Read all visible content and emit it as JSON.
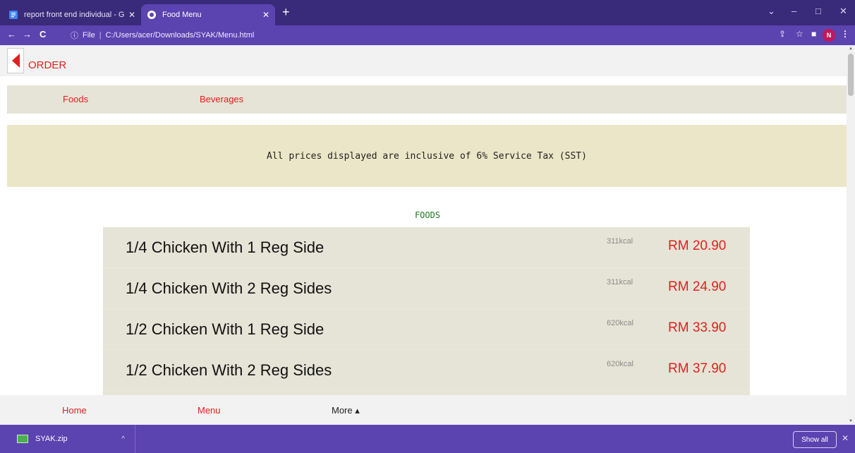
{
  "browser": {
    "tabs": [
      {
        "title": "report front end individual - Goo",
        "active": false
      },
      {
        "title": "Food Menu",
        "active": true
      }
    ],
    "new_tab_label": "+",
    "window_controls": [
      "⌄",
      "–",
      "□",
      "✕"
    ],
    "nav": {
      "back": "←",
      "forward": "→",
      "reload": "C"
    },
    "address": {
      "scheme": "File",
      "path": "C:/Users/acer/Downloads/SYAK/Menu.html"
    },
    "profile_initial": "N"
  },
  "page": {
    "header_title": "ORDER",
    "categories": [
      "Foods",
      "Beverages"
    ],
    "notice": "All prices displayed are inclusive of 6% Service Tax (SST)",
    "section_title": "FOODS",
    "items": [
      {
        "name": "1/4 Chicken With 1 Reg Side",
        "kcal": "311kcal",
        "price": "RM 20.90"
      },
      {
        "name": "1/4 Chicken With 2 Reg Sides",
        "kcal": "311kcal",
        "price": "RM 24.90"
      },
      {
        "name": "1/2 Chicken With 1 Reg Side",
        "kcal": "620kcal",
        "price": "RM 33.90"
      },
      {
        "name": "1/2 Chicken With 2 Reg Sides",
        "kcal": "620kcal",
        "price": "RM 37.90"
      }
    ],
    "bottom_nav": {
      "home": "Home",
      "menu": "Menu",
      "more": "More ▴"
    }
  },
  "downloads": {
    "file_name": "SYAK.zip",
    "show_all": "Show all",
    "close": "✕"
  },
  "colors": {
    "accent": "#5b43b0",
    "link_red": "#e02020",
    "panel": "#e6e4d6",
    "notice_bg": "#ece6c8",
    "section_green": "#1f7a1f"
  }
}
